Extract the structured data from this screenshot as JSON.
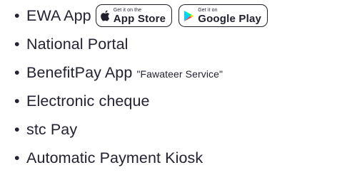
{
  "items": [
    {
      "label": "EWA App"
    },
    {
      "label": "National Portal"
    },
    {
      "label": "BenefitPay App",
      "note": "\"Fawateer Service\""
    },
    {
      "label": "Electronic cheque"
    },
    {
      "label": "stc Pay"
    },
    {
      "label": "Automatic Payment Kiosk"
    }
  ],
  "bullet": "•",
  "badges": {
    "app_store": {
      "small": "Get it on the",
      "big": "App Store",
      "icon": "apple-icon"
    },
    "google_play": {
      "small": "Get it on",
      "big": "Google Play",
      "icon": "google-play-icon"
    }
  },
  "colors": {
    "text": "#222233",
    "badge_border": "#1f1f2e"
  }
}
